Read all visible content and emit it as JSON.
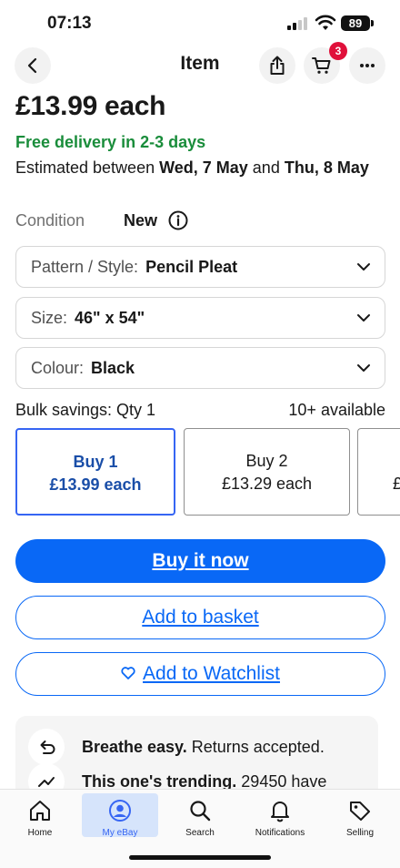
{
  "status_bar": {
    "time": "07:13",
    "battery": "89"
  },
  "nav": {
    "title": "Item",
    "cart_count": "3"
  },
  "item": {
    "price": "£13.99 each",
    "delivery": "Free delivery in 2-3 days",
    "estimate_prefix": "Estimated between ",
    "estimate_start": "Wed, 7 May",
    "estimate_mid": " and ",
    "estimate_end": "Thu, 8 May",
    "condition_label": "Condition",
    "condition_value": "New"
  },
  "variations": [
    {
      "label": "Pattern / Style:",
      "value": "Pencil Pleat"
    },
    {
      "label": "Size:",
      "value": "46\" x 54\""
    },
    {
      "label": "Colour:",
      "value": "Black"
    }
  ],
  "bulk": {
    "label": "Bulk savings: Qty 1",
    "available": "10+ available",
    "options": [
      {
        "title": "Buy 1",
        "price": "£13.99 each",
        "selected": true
      },
      {
        "title": "Buy 2",
        "price": "£13.29 each",
        "selected": false
      },
      {
        "title": "",
        "price": "£",
        "selected": false
      }
    ]
  },
  "actions": {
    "buy_now": "Buy it now",
    "add_to_basket": "Add to basket",
    "add_to_watchlist": "Add to Watchlist"
  },
  "trust": [
    {
      "icon": "return-arrow-icon",
      "bold": "Breathe easy.",
      "text": " Returns accepted."
    },
    {
      "icon": "trending-icon",
      "bold": "This one's trending.",
      "text": " 29450 have"
    }
  ],
  "tabs": [
    {
      "label": "Home",
      "icon": "home-icon",
      "active": false
    },
    {
      "label": "My eBay",
      "icon": "account-icon",
      "active": true
    },
    {
      "label": "Search",
      "icon": "search-icon",
      "active": false
    },
    {
      "label": "Notifications",
      "icon": "bell-icon",
      "active": false
    },
    {
      "label": "Selling",
      "icon": "tag-icon",
      "active": false
    }
  ],
  "colors": {
    "accent": "#0968f6",
    "delivery_green": "#1a8d3b",
    "badge_red": "#e0103a"
  }
}
